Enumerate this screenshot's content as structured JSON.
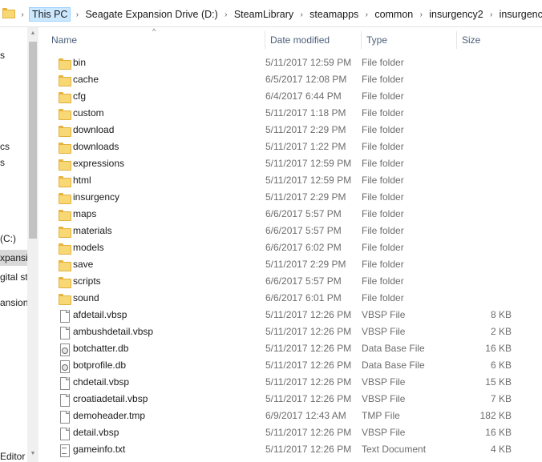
{
  "breadcrumbs": [
    "This PC",
    "Seagate Expansion Drive (D:)",
    "SteamLibrary",
    "steamapps",
    "common",
    "insurgency2",
    "insurgency"
  ],
  "nav": {
    "items": [
      {
        "label": "s",
        "selected": false
      },
      {
        "label": "cs",
        "selected": false
      },
      {
        "label": "s",
        "selected": false
      },
      {
        "label": "(C:)",
        "selected": false
      },
      {
        "label": "xpansio",
        "selected": true
      },
      {
        "label": "gital st",
        "selected": false
      },
      {
        "label": "ansion",
        "selected": false
      },
      {
        "label": "Editor",
        "selected": false
      }
    ]
  },
  "columns": {
    "name": "Name",
    "date": "Date modified",
    "type": "Type",
    "size": "Size"
  },
  "files": [
    {
      "name": "bin",
      "date": "5/11/2017 12:59 PM",
      "type": "File folder",
      "size": "",
      "icon": "folder-icon"
    },
    {
      "name": "cache",
      "date": "6/5/2017 12:08 PM",
      "type": "File folder",
      "size": "",
      "icon": "folder-icon"
    },
    {
      "name": "cfg",
      "date": "6/4/2017 6:44 PM",
      "type": "File folder",
      "size": "",
      "icon": "folder-icon"
    },
    {
      "name": "custom",
      "date": "5/11/2017 1:18 PM",
      "type": "File folder",
      "size": "",
      "icon": "folder-icon"
    },
    {
      "name": "download",
      "date": "5/11/2017 2:29 PM",
      "type": "File folder",
      "size": "",
      "icon": "folder-icon"
    },
    {
      "name": "downloads",
      "date": "5/11/2017 1:22 PM",
      "type": "File folder",
      "size": "",
      "icon": "folder-icon"
    },
    {
      "name": "expressions",
      "date": "5/11/2017 12:59 PM",
      "type": "File folder",
      "size": "",
      "icon": "folder-icon"
    },
    {
      "name": "html",
      "date": "5/11/2017 12:59 PM",
      "type": "File folder",
      "size": "",
      "icon": "folder-icon"
    },
    {
      "name": "insurgency",
      "date": "5/11/2017 2:29 PM",
      "type": "File folder",
      "size": "",
      "icon": "folder-icon"
    },
    {
      "name": "maps",
      "date": "6/6/2017 5:57 PM",
      "type": "File folder",
      "size": "",
      "icon": "folder-icon"
    },
    {
      "name": "materials",
      "date": "6/6/2017 5:57 PM",
      "type": "File folder",
      "size": "",
      "icon": "folder-icon"
    },
    {
      "name": "models",
      "date": "6/6/2017 6:02 PM",
      "type": "File folder",
      "size": "",
      "icon": "folder-icon"
    },
    {
      "name": "save",
      "date": "5/11/2017 2:29 PM",
      "type": "File folder",
      "size": "",
      "icon": "folder-icon"
    },
    {
      "name": "scripts",
      "date": "6/6/2017 5:57 PM",
      "type": "File folder",
      "size": "",
      "icon": "folder-icon"
    },
    {
      "name": "sound",
      "date": "6/6/2017 6:01 PM",
      "type": "File folder",
      "size": "",
      "icon": "folder-icon"
    },
    {
      "name": "afdetail.vbsp",
      "date": "5/11/2017 12:26 PM",
      "type": "VBSP File",
      "size": "8 KB",
      "icon": "file-icon"
    },
    {
      "name": "ambushdetail.vbsp",
      "date": "5/11/2017 12:26 PM",
      "type": "VBSP File",
      "size": "2 KB",
      "icon": "file-icon"
    },
    {
      "name": "botchatter.db",
      "date": "5/11/2017 12:26 PM",
      "type": "Data Base File",
      "size": "16 KB",
      "icon": "database-icon"
    },
    {
      "name": "botprofile.db",
      "date": "5/11/2017 12:26 PM",
      "type": "Data Base File",
      "size": "6 KB",
      "icon": "database-icon"
    },
    {
      "name": "chdetail.vbsp",
      "date": "5/11/2017 12:26 PM",
      "type": "VBSP File",
      "size": "15 KB",
      "icon": "file-icon"
    },
    {
      "name": "croatiadetail.vbsp",
      "date": "5/11/2017 12:26 PM",
      "type": "VBSP File",
      "size": "7 KB",
      "icon": "file-icon"
    },
    {
      "name": "demoheader.tmp",
      "date": "6/9/2017 12:43 AM",
      "type": "TMP File",
      "size": "182 KB",
      "icon": "file-icon"
    },
    {
      "name": "detail.vbsp",
      "date": "5/11/2017 12:26 PM",
      "type": "VBSP File",
      "size": "16 KB",
      "icon": "file-icon"
    },
    {
      "name": "gameinfo.txt",
      "date": "5/11/2017 12:26 PM",
      "type": "Text Document",
      "size": "4 KB",
      "icon": "text-document-icon"
    }
  ]
}
